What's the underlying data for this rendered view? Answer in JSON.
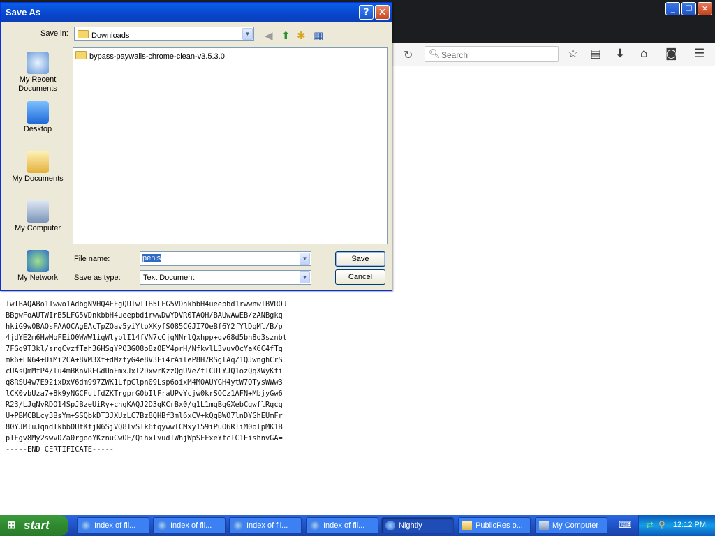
{
  "dialog": {
    "title": "Save As",
    "help_label": "?",
    "close_label": "✕",
    "save_in_label": "Save in:",
    "save_in_value": "Downloads",
    "places": [
      {
        "label": "My Recent Documents"
      },
      {
        "label": "Desktop"
      },
      {
        "label": "My Documents"
      },
      {
        "label": "My Computer"
      },
      {
        "label": "My Network"
      }
    ],
    "files": [
      "bypass-paywalls-chrome-clean-v3.5.3.0"
    ],
    "file_name_label": "File name:",
    "file_name_value": "penis",
    "save_as_type_label": "Save as type:",
    "save_as_type_value": "Text Document",
    "save_button": "Save",
    "cancel_button": "Cancel"
  },
  "browser": {
    "search_placeholder": "Search",
    "window_buttons": [
      "_",
      "❐",
      "✕"
    ]
  },
  "page_text": [
    "IwIBAQABo1Iwwo1AdbgNVHQ4EFgQUIwIIB5LFG5VDnkbbH4ueepbd1rwwnwIBVROJ",
    "BBgwFoAUTWIrB5LFG5VDnkbbH4ueepbdirwwDwYDVR0TAQH/BAUwAwEB/zANBgkq",
    "hkiG9w0BAQsFAAOCAgEAcTpZQav5yiYtoXKyfS085CGJI7OeBf6Y2fYlDqMl/B/p",
    "4jdYE2m6HwMoFEiO0WWW1igWlyblI14fVN7cCjgNNrlQxhpp+qv68d5bh8o3sznbt",
    "7FGg9T3kl/srgCvzfTah36HSgYPO3G08o8zOEY4prH/NfkvlL3vuv0cYaK6C4fTq",
    "mk6+LN64+UiMi2CA+8VM3Xf+dMzfyG4e8V3Ei4rAileP8H7RSglAqZ1QJwnghCrS",
    "cUAsQmMfP4/lu4mBKnVREGdUoFmxJxl2DxwrKzzQgUVeZfTCUlYJQ1ozQqXWyKfi",
    "q8RSU4w7E92ixDxV6dm997ZWK1LfpClpn09Lsp6oixM4MOAUYGH4ytW7OTysWWw3",
    "lCK0vbUza7+8k9yNGCFutfdZKTrgprG0bIlFraUPvYcjw0krSOCz1AFN+MbjyGw6",
    "R23/LJqNvRDO14SpJBzeUiRy+cngKAQJ2D3gKCrBx0/g1L1mgBgGXebCgwflRgcq",
    "U+PBMCBLcy3BsYm+SSQbkDT3JXUzLC7Bz8QHBf3ml6xCV+kQqBWO7lnDYGhEUmFr",
    "80YJMluJqndTkbb0UtKfjN6SjVQ8TvSTk6tqywwICMxy159iPuO6RTiM0olpMK1B",
    "pIFgv8My2swvDZa0rgooYKznuCwOE/QihxlvudTWhjWpSFFxeYfclC1EishnvGA=",
    "-----END CERTIFICATE-----"
  ],
  "taskbar": {
    "start_label": "start",
    "tasks": [
      {
        "label": "Index of fil..."
      },
      {
        "label": "Index of fil..."
      },
      {
        "label": "Index of fil..."
      },
      {
        "label": "Index of fil..."
      },
      {
        "label": "Nightly"
      },
      {
        "label": "PublicRes o..."
      },
      {
        "label": "My Computer"
      }
    ],
    "clock": "12:12 PM"
  }
}
